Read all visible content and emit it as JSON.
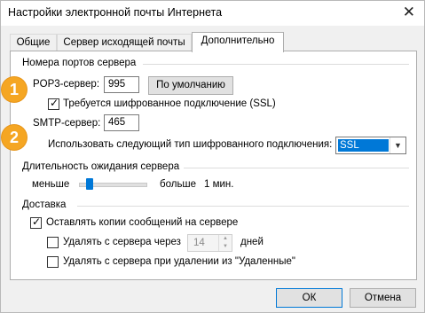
{
  "window": {
    "title": "Настройки электронной почты Интернета",
    "close_glyph": "✕"
  },
  "tabs": [
    {
      "label": "Общие"
    },
    {
      "label": "Сервер исходящей почты"
    },
    {
      "label": "Дополнительно"
    }
  ],
  "ports": {
    "group_title": "Номера портов сервера",
    "pop3_label": "POP3-сервер:",
    "pop3_value": "995",
    "default_button": "По умолчанию",
    "ssl_required_label": "Требуется шифрованное подключение (SSL)",
    "ssl_required_checked": true,
    "smtp_label": "SMTP-сервер:",
    "smtp_value": "465",
    "encryption_label": "Использовать следующий тип шифрованного подключения:",
    "encryption_value": "SSL"
  },
  "timeout": {
    "group_title": "Длительность ожидания сервера",
    "less_label": "меньше",
    "more_label": "больше",
    "value_label": "1 мин.",
    "slider_fraction": 0.1
  },
  "delivery": {
    "group_title": "Доставка",
    "keep_copies_label": "Оставлять копии сообщений на сервере",
    "keep_copies_checked": true,
    "delete_after_label": "Удалять с сервера через",
    "delete_after_value": "14",
    "days_label": "дней",
    "delete_on_remove_label": "Удалять с сервера при удалении из \"Удаленные\""
  },
  "footer": {
    "ok_label": "ОК",
    "cancel_label": "Отмена"
  },
  "badges": [
    "1",
    "2"
  ],
  "colors": {
    "badge": "#f5a623",
    "accent": "#0078d7"
  }
}
